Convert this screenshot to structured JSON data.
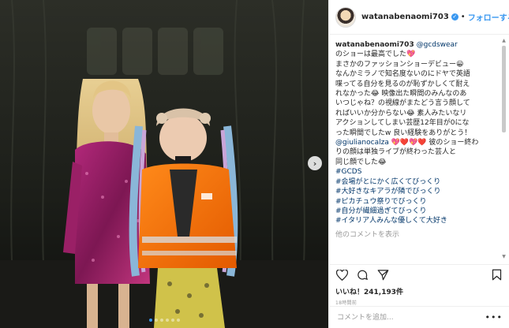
{
  "post": {
    "username": "watanabenaomi703",
    "follow_sep": "•",
    "follow_label": "フォローする",
    "caption_author": "watanabenaomi703",
    "caption_mention": "@gcdswear",
    "caption_lines": [
      "のショーは最高でした💖",
      "まさかのファッションショーデビュー😀",
      "なんかミラノで知名度ないのにドヤで英語",
      "喋ってる自分を見るのが恥ずかしくて耐え",
      "れなかった😂 映像出た瞬間のみんなのあ",
      "いつじゃね？の視線がまたどう言う顔して",
      "ればいいか分からない😂 素人みたいなリ",
      "アクションしてしまい芸歴12年目が0にな",
      "った瞬間でしたw 良い経験をありがとう！"
    ],
    "caption_mention2": "@giulianocalza",
    "caption_after_mention2": " 💖❤️💖❤️ 彼のショー終わ",
    "caption_lines2": [
      "りの顔は単独ライブが終わった芸人と",
      "同じ顔でした😂"
    ],
    "hashtags": [
      "#GCDS",
      "#会場がとにかく広くてびっくり",
      "#大好きなキアラが隣でびっくり",
      "#ピカチュウ祭りでびっくり",
      "#自分が繊細過ぎてびっくり",
      "#イタリア人みんな優しくて大好き"
    ],
    "more_comments": "他のコメントを表示",
    "likes_prefix": "いいね！",
    "likes_count": "241,193件",
    "time_ago": "18時間前",
    "comment_placeholder": "コメントを追加...",
    "more_label": "•••",
    "next_arrow": "›",
    "carousel": {
      "count": 6,
      "active_index": 0
    },
    "verified_glyph": "✓"
  },
  "colors": {
    "accent": "#3897f0",
    "link": "#003569",
    "text": "#262626",
    "muted": "#999999"
  }
}
